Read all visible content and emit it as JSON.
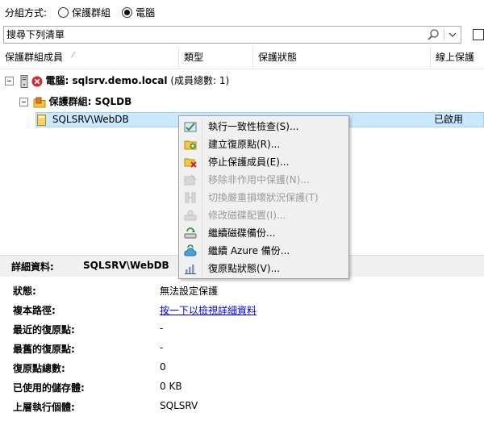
{
  "groupby": {
    "label": "分組方式:",
    "options": [
      {
        "label": "保護群組",
        "selected": false
      },
      {
        "label": "電腦",
        "selected": true
      }
    ]
  },
  "search": {
    "value": "搜尋下列清單",
    "placeholder": "搜尋下列清單"
  },
  "columns": [
    "保護群組成員",
    "類型",
    "保護狀態",
    "線上保護"
  ],
  "tree": {
    "computer": {
      "label": "電腦: sqlsrv.demo.local",
      "suffix": " (成員總數: 1)"
    },
    "group": {
      "label": "保護群組: SQLDB"
    },
    "member": {
      "name": "SQLSRV\\WebDB",
      "online_protection": "已啟用"
    }
  },
  "context_menu": {
    "items": [
      {
        "label": "執行一致性檢查(S)...",
        "icon": "consistency-check-icon",
        "enabled": true
      },
      {
        "label": "建立復原點(R)...",
        "icon": "create-recovery-point-icon",
        "enabled": true
      },
      {
        "label": "停止保護成員(E)...",
        "icon": "stop-protection-icon",
        "enabled": true
      },
      {
        "label": "移除非作用中保護(N)...",
        "icon": "remove-inactive-icon",
        "enabled": false
      },
      {
        "label": "切換嚴重損壞狀況保護(T)",
        "icon": "switch-disaster-protection-icon",
        "enabled": false
      },
      {
        "label": "修改磁碟配置(I)...",
        "icon": "modify-disk-icon",
        "enabled": false
      },
      {
        "label": "繼續磁碟備份...",
        "icon": "resume-disk-backup-icon",
        "enabled": true
      },
      {
        "label": "繼續 Azure 備份...",
        "icon": "resume-azure-backup-icon",
        "enabled": true
      },
      {
        "label": "復原點狀態(V)...",
        "icon": "recovery-point-status-icon",
        "enabled": true
      }
    ]
  },
  "details": {
    "header_label": "詳細資料:",
    "header_value": "SQLSRV\\WebDB",
    "rows": [
      {
        "label": "狀態:",
        "value": "無法設定保護"
      },
      {
        "label": "複本路徑:",
        "value": "按一下以檢視詳細資料"
      },
      {
        "label": "最近的復原點:",
        "value": "-"
      },
      {
        "label": "最舊的復原點:",
        "value": "-"
      },
      {
        "label": "復原點總數:",
        "value": "0"
      },
      {
        "label": "已使用的儲存體:",
        "value": "0 KB"
      },
      {
        "label": "上層執行個體:",
        "value": "SQLSRV"
      }
    ]
  },
  "colors": {
    "selection": "#cce8ff",
    "selection_border": "#99d1ff",
    "error": "#d9242a",
    "link": "#0000ee"
  }
}
